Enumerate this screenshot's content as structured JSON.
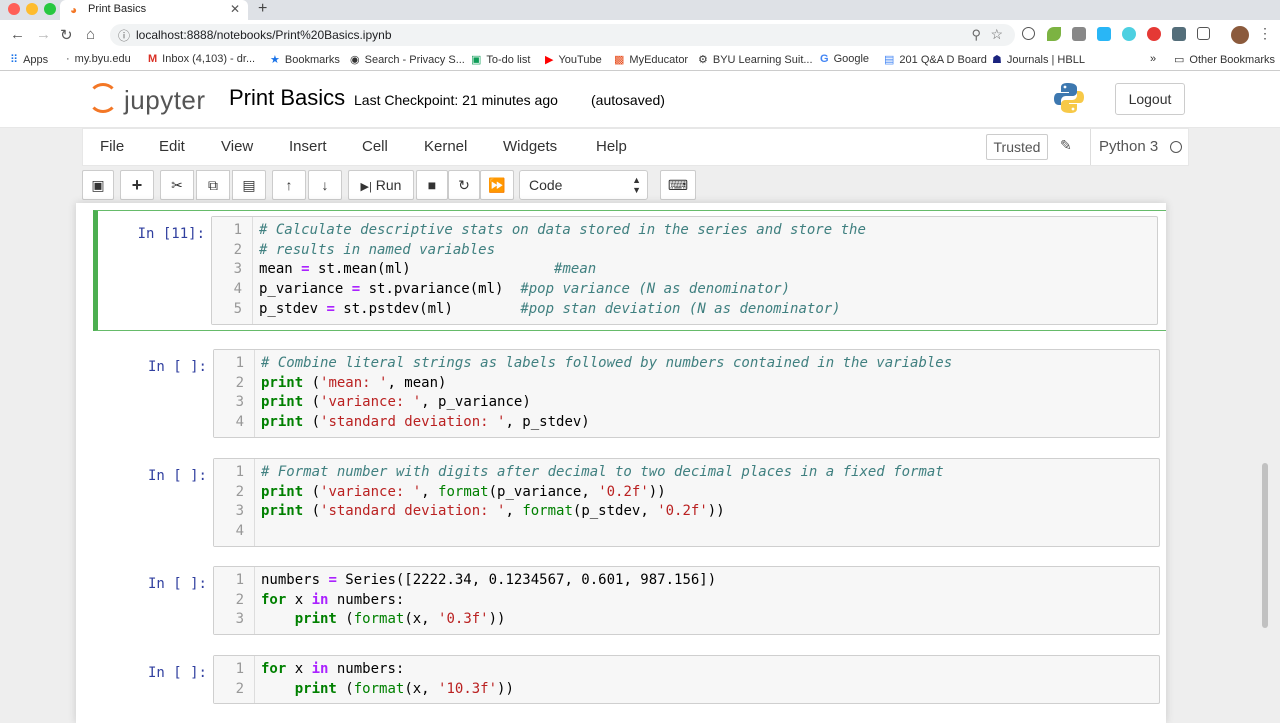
{
  "browser": {
    "tab_title": "Print Basics",
    "url": "localhost:8888/notebooks/Print%20Basics.ipynb",
    "bookmarks": [
      "Apps",
      "my.byu.edu",
      "Inbox (4,103) - dr...",
      "Bookmarks",
      "Search - Privacy S...",
      "To-do list",
      "YouTube",
      "MyEducator",
      "BYU Learning Suit...",
      "Google",
      "201 Q&A D Board",
      "Journals | HBLL"
    ],
    "other_bookmarks": "Other Bookmarks"
  },
  "jupyter": {
    "logo_text": "jupyter",
    "notebook_title": "Print Basics",
    "checkpoint": "Last Checkpoint: 21 minutes ago",
    "autosave": "(autosaved)",
    "logout": "Logout",
    "menus": [
      "File",
      "Edit",
      "View",
      "Insert",
      "Cell",
      "Kernel",
      "Widgets",
      "Help"
    ],
    "trusted": "Trusted",
    "kernel": "Python 3",
    "run_label": "Run",
    "cell_type": "Code"
  },
  "cells": [
    {
      "prompt": "In [11]:",
      "selected": true,
      "lines": [
        [
          [
            "cm",
            "# Calculate descriptive stats on data stored in the series and store the"
          ]
        ],
        [
          [
            "cm",
            "# results in named variables"
          ]
        ],
        [
          [
            "",
            "mean "
          ],
          [
            "op",
            "="
          ],
          [
            "",
            " st.mean(ml)                 "
          ],
          [
            "cm",
            "#mean"
          ]
        ],
        [
          [
            "",
            "p_variance "
          ],
          [
            "op",
            "="
          ],
          [
            "",
            " st.pvariance(ml)  "
          ],
          [
            "cm",
            "#pop variance (N as denominator)"
          ]
        ],
        [
          [
            "",
            "p_stdev "
          ],
          [
            "op",
            "="
          ],
          [
            "",
            " st.pstdev(ml)        "
          ],
          [
            "cm",
            "#pop stan deviation (N as denominator)"
          ]
        ]
      ]
    },
    {
      "prompt": "In [ ]:",
      "selected": false,
      "lines": [
        [
          [
            "cm",
            "# Combine literal strings as labels followed by numbers contained in the variables"
          ]
        ],
        [
          [
            "kw",
            "print"
          ],
          [
            "",
            " ("
          ],
          [
            "st",
            "'mean: '"
          ],
          [
            "",
            ", mean)"
          ]
        ],
        [
          [
            "kw",
            "print"
          ],
          [
            "",
            " ("
          ],
          [
            "st",
            "'variance: '"
          ],
          [
            "",
            ", p_variance)"
          ]
        ],
        [
          [
            "kw",
            "print"
          ],
          [
            "",
            " ("
          ],
          [
            "st",
            "'standard deviation: '"
          ],
          [
            "",
            ", p_stdev)"
          ]
        ]
      ]
    },
    {
      "prompt": "In [ ]:",
      "selected": false,
      "lines": [
        [
          [
            "cm",
            "# Format number with digits after decimal to two decimal places in a fixed format"
          ]
        ],
        [
          [
            "kw",
            "print"
          ],
          [
            "",
            " ("
          ],
          [
            "st",
            "'variance: '"
          ],
          [
            "",
            ", "
          ],
          [
            "nm",
            "format"
          ],
          [
            "",
            "(p_variance, "
          ],
          [
            "st",
            "'0.2f'"
          ],
          [
            "",
            "))"
          ]
        ],
        [
          [
            "kw",
            "print"
          ],
          [
            "",
            " ("
          ],
          [
            "st",
            "'standard deviation: '"
          ],
          [
            "",
            ", "
          ],
          [
            "nm",
            "format"
          ],
          [
            "",
            "(p_stdev, "
          ],
          [
            "st",
            "'0.2f'"
          ],
          [
            "",
            "))"
          ]
        ],
        [
          [
            "",
            ""
          ]
        ]
      ]
    },
    {
      "prompt": "In [ ]:",
      "selected": false,
      "lines": [
        [
          [
            "",
            "numbers "
          ],
          [
            "op",
            "="
          ],
          [
            "",
            " Series([2222.34, 0.1234567, 0.601, 987.156])"
          ]
        ],
        [
          [
            "kw",
            "for"
          ],
          [
            "",
            " x "
          ],
          [
            "op",
            "in"
          ],
          [
            "",
            " numbers:"
          ]
        ],
        [
          [
            "",
            "    "
          ],
          [
            "kw",
            "print"
          ],
          [
            "",
            " ("
          ],
          [
            "nm",
            "format"
          ],
          [
            "",
            "(x, "
          ],
          [
            "st",
            "'0.3f'"
          ],
          [
            "",
            "))"
          ]
        ]
      ]
    },
    {
      "prompt": "In [ ]:",
      "selected": false,
      "lines": [
        [
          [
            "kw",
            "for"
          ],
          [
            "",
            " x "
          ],
          [
            "op",
            "in"
          ],
          [
            "",
            " numbers:"
          ]
        ],
        [
          [
            "",
            "    "
          ],
          [
            "kw",
            "print"
          ],
          [
            "",
            " ("
          ],
          [
            "nm",
            "format"
          ],
          [
            "",
            "(x, "
          ],
          [
            "st",
            "'10.3f'"
          ],
          [
            "",
            "))"
          ]
        ]
      ]
    }
  ]
}
